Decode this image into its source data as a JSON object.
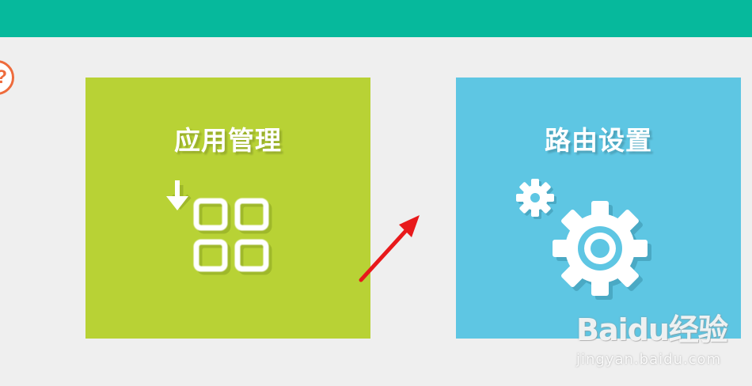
{
  "colors": {
    "top_bar": "#06b99c",
    "background": "#efefef",
    "help_accent": "#ee6b3c",
    "apps_tile": "#b8d235",
    "router_tile": "#5ec6e3",
    "annotation_arrow": "#e8191b"
  },
  "help": {
    "icon": "question-icon",
    "glyph": "?"
  },
  "tiles": [
    {
      "label": "应用管理",
      "icon": "app-grid-download-icon"
    },
    {
      "label": "路由设置",
      "icon": "gear-settings-icon"
    }
  ],
  "watermark": {
    "logo": "Baidu经验",
    "url": "jingyan.baidu.com"
  }
}
